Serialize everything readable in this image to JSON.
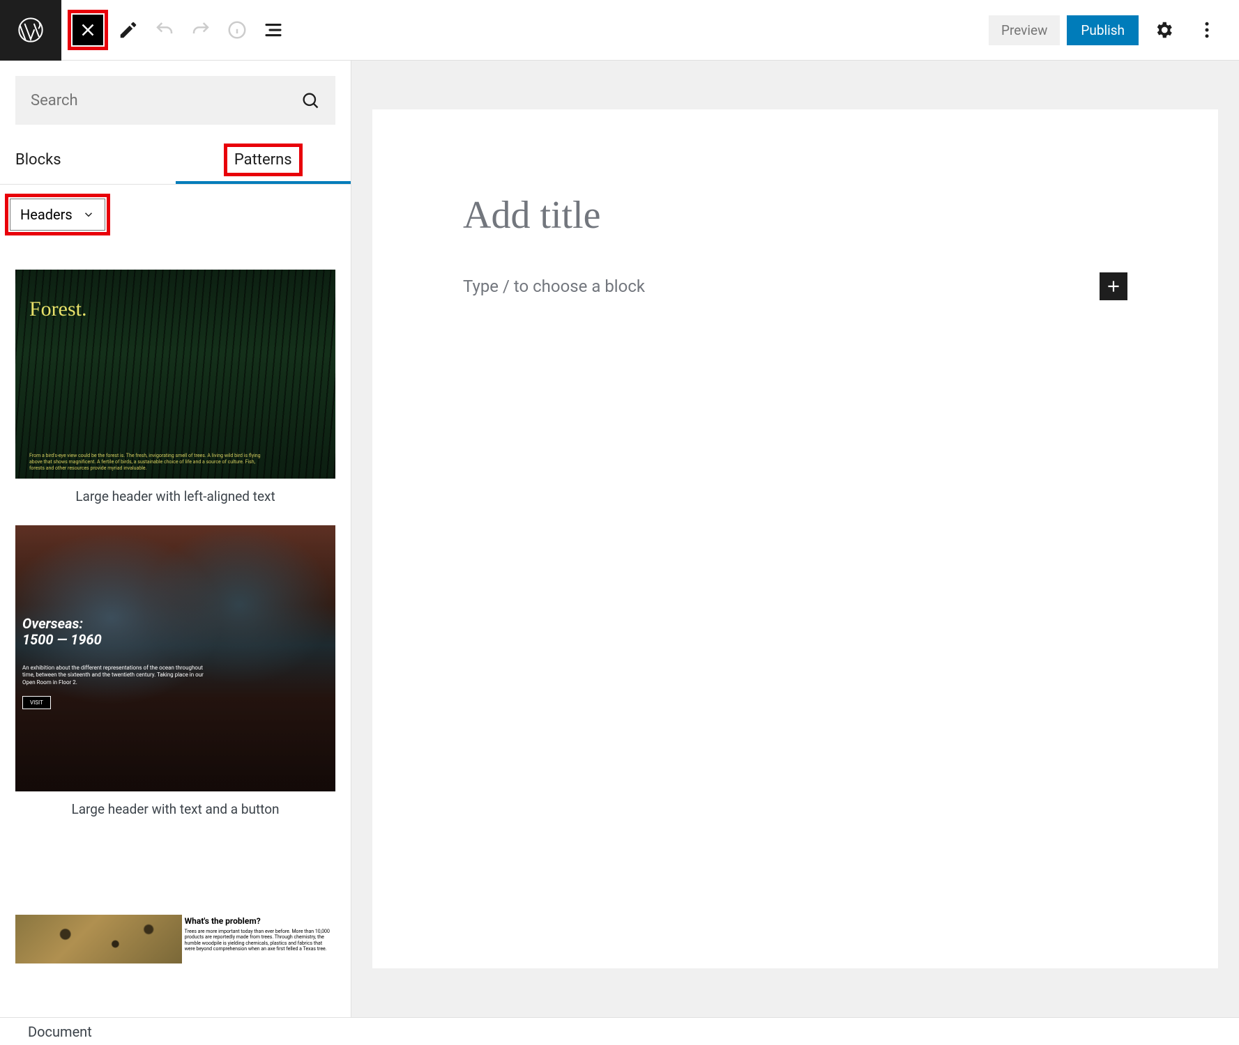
{
  "toolbar": {
    "preview_label": "Preview",
    "publish_label": "Publish"
  },
  "inserter": {
    "search_placeholder": "Search",
    "tabs": {
      "blocks": "Blocks",
      "patterns": "Patterns"
    },
    "category_selected": "Headers",
    "patterns": [
      {
        "title": "Forest.",
        "blurb": "From a bird's-eye view could be the forest is. The fresh, invigorating smell of trees. A living wild bird is flying above that shows magnificent. A fertile of birds, a sustainable choice of life and a source of culture. Fish, forests and other resources provide myriad invaluable.",
        "caption": "Large header with left-aligned text"
      },
      {
        "title_line1": "Overseas:",
        "title_line2": "1500 — 1960",
        "desc": "An exhibition about the different representations of the ocean throughout time, between the sixteenth and the twentieth century. Taking place in our Open Room in Floor 2.",
        "button": "VISIT",
        "caption": "Large header with text and a button"
      },
      {
        "heading": "What's the problem?",
        "body": "Trees are more important today than ever before. More than 10,000 products are reportedly made from trees. Through chemistry, the humble woodpile is yielding chemicals, plastics and fabrics that were beyond comprehension when an axe first felled a Texas tree.",
        "caption": ""
      }
    ]
  },
  "canvas": {
    "title_placeholder": "Add title",
    "block_placeholder": "Type / to choose a block"
  },
  "footer": {
    "breadcrumb": "Document"
  }
}
